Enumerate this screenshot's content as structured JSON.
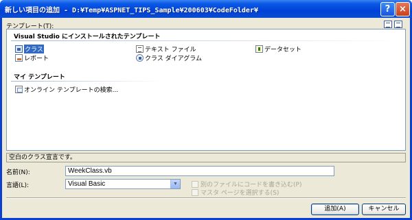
{
  "window": {
    "title": "新しい項目の追加 - D:¥Temp¥ASPNET_TIPS_Sample¥200603¥CodeFolder¥",
    "help_glyph": "?",
    "close_glyph": "×"
  },
  "templates": {
    "label": "テンプレート(T):",
    "installed_group": "Visual Studio にインストールされたテンプレート",
    "installed_items": [
      {
        "label": "クラス",
        "icon": "class-icon",
        "selected": true
      },
      {
        "label": "テキスト ファイル",
        "icon": "text-file-icon",
        "selected": false
      },
      {
        "label": "データセット",
        "icon": "dataset-icon",
        "selected": false
      },
      {
        "label": "レポート",
        "icon": "report-icon",
        "selected": false
      },
      {
        "label": "クラス ダイアグラム",
        "icon": "class-diagram-icon",
        "selected": false
      }
    ],
    "my_group": "マイ テンプレート",
    "my_items": [
      {
        "label": "オンライン テンプレートの検索...",
        "icon": "online-search-icon"
      }
    ]
  },
  "description": "空白のクラス宣言です。",
  "form": {
    "name_label": "名前(N):",
    "name_value": "WeekClass.vb",
    "language_label": "言語(L):",
    "language_value": "Visual Basic",
    "options": [
      {
        "label": "別のファイルにコードを書き込む(P)",
        "checked": false,
        "enabled": false
      },
      {
        "label": "マスタ ページを選択する(S)",
        "checked": false,
        "enabled": false
      }
    ]
  },
  "buttons": {
    "add_label": "追加(A)",
    "cancel_label": "キャンセル"
  }
}
